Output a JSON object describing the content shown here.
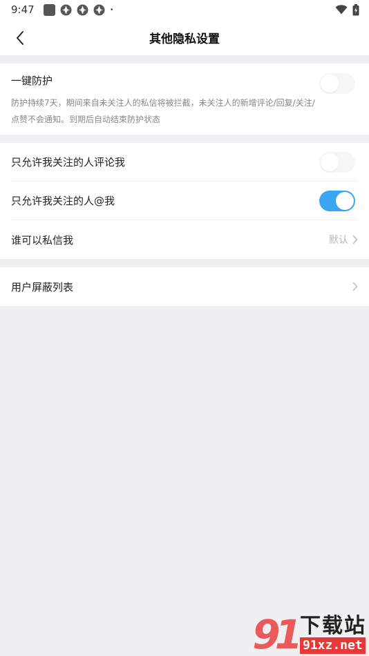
{
  "status_bar": {
    "time": "9:47",
    "left_icons": [
      "notification-square-icon",
      "app-icon",
      "app-icon",
      "app-icon"
    ],
    "dot": "•",
    "right_icons": [
      "wifi-icon",
      "battery-icon"
    ]
  },
  "header": {
    "back_icon": "chevron-left-icon",
    "title": "其他隐私设置"
  },
  "protection": {
    "label": "一键防护",
    "desc_line1": "防护持续7天，期间来自未关注人的私信将被拦截，未关注人的新增评论/回复/关注/",
    "desc_line2": "点赞不会通知。到期后自动结束防护状态",
    "enabled": false
  },
  "settings": {
    "comment_only_following": {
      "label": "只允许我关注的人评论我",
      "enabled": false
    },
    "mention_only_following": {
      "label": "只允许我关注的人@我",
      "enabled": true
    },
    "who_can_dm": {
      "label": "谁可以私信我",
      "value": "默认"
    }
  },
  "block_list": {
    "label": "用户屏蔽列表"
  },
  "watermark": {
    "logo": "91",
    "text_cn": "下载站",
    "text_url": "91xz.net"
  },
  "colors": {
    "accent": "#3aa6f3",
    "page_bg": "#f0f0f2",
    "watermark_red": "#e43a3a"
  }
}
